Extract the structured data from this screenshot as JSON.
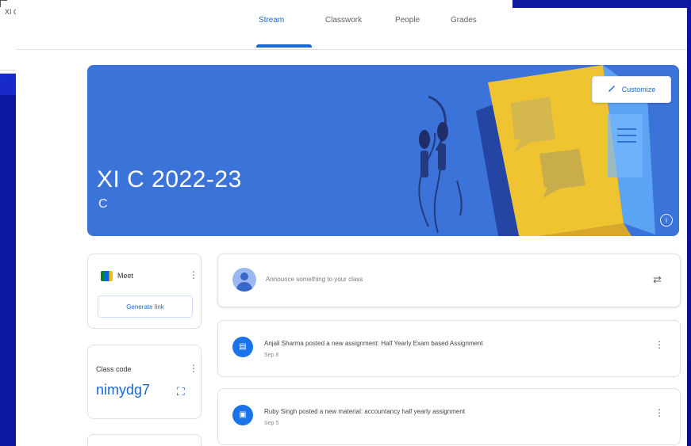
{
  "top_left_panel": {
    "title": "XI C 2022-23",
    "subtitle": "C"
  },
  "tabs": [
    {
      "label": "Stream",
      "active": true
    },
    {
      "label": "Classwork",
      "active": false
    },
    {
      "label": "People",
      "active": false
    },
    {
      "label": "Grades",
      "active": false
    }
  ],
  "banner": {
    "title": "XI C 2022-23",
    "subtitle": "C",
    "customize_label": "Customize",
    "info_icon": "info-icon"
  },
  "meet": {
    "label": "Meet",
    "generate_link_label": "Generate link"
  },
  "class_code": {
    "label": "Class code",
    "value": "nimydg7"
  },
  "announce": {
    "placeholder": "Announce something to your class"
  },
  "posts": [
    {
      "text": "Anjali Sharma posted a new assignment: Half Yearly Exam based Assignment",
      "date": "Sep 8"
    },
    {
      "text": "Ruby Singh posted a new material: accountancy half yearly assignment",
      "date": "Sep 5"
    }
  ],
  "colors": {
    "brand_blue": "#1967d2",
    "banner_blue": "#3b73d8",
    "background_blue": "#0d1aa6"
  }
}
